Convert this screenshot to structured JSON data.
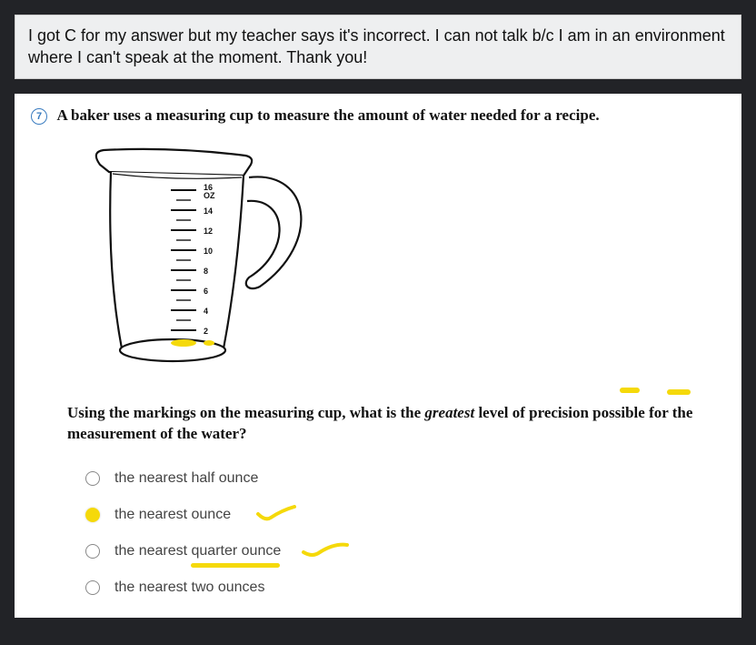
{
  "message": "I got C for my answer but my teacher says it's incorrect. I can not talk b/c I am in an environment where I can't speak at the moment. Thank you!",
  "question": {
    "number": "7",
    "prompt": "A baker uses a measuring cup to measure the amount of water needed for a recipe.",
    "sub_prefix": "Using the markings on the measuring cup, what is the ",
    "sub_italic": "greatest",
    "sub_suffix": " level of precision possible for the measurement of the water?",
    "cup_labels": {
      "top_line1": "16",
      "top_line2": "OZ",
      "l14": "14",
      "l12": "12",
      "l10": "10",
      "l8": "8",
      "l6": "6",
      "l4": "4",
      "l2": "2"
    },
    "options": [
      {
        "label": "the nearest half ounce",
        "selected": false
      },
      {
        "label": "the nearest ounce",
        "selected": true
      },
      {
        "label": "the nearest quarter ounce",
        "selected": false
      },
      {
        "label": "the nearest two ounces",
        "selected": false
      }
    ]
  }
}
